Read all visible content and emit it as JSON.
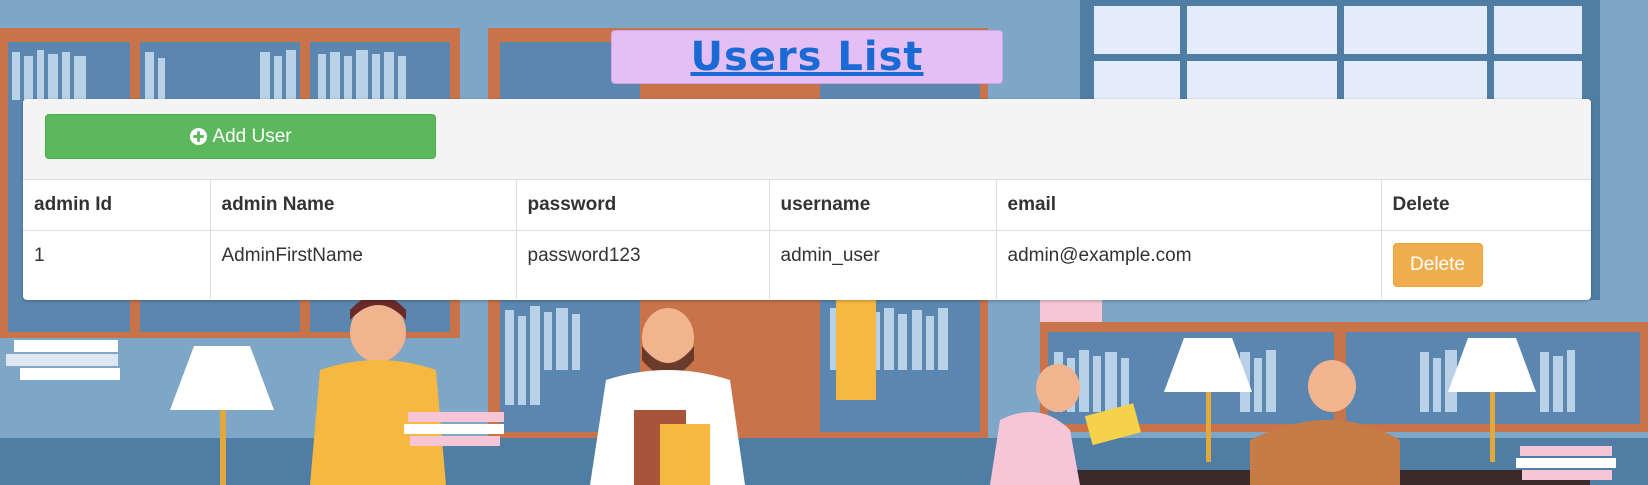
{
  "page": {
    "title": "Users List",
    "title_color": "#1a6ad6",
    "title_bg": "#e4bff5"
  },
  "toolbar": {
    "add_label": "Add User",
    "add_icon": "plus-circle-icon",
    "add_color": "#5cb85c"
  },
  "table": {
    "headers": [
      "admin Id",
      "admin Name",
      "password",
      "username",
      "email",
      "Delete"
    ],
    "rows": [
      {
        "id": "1",
        "name": "AdminFirstName",
        "password": "password123",
        "username": "admin_user",
        "email": "admin@example.com",
        "delete_label": "Delete"
      }
    ],
    "delete_color": "#f0ad4e"
  }
}
